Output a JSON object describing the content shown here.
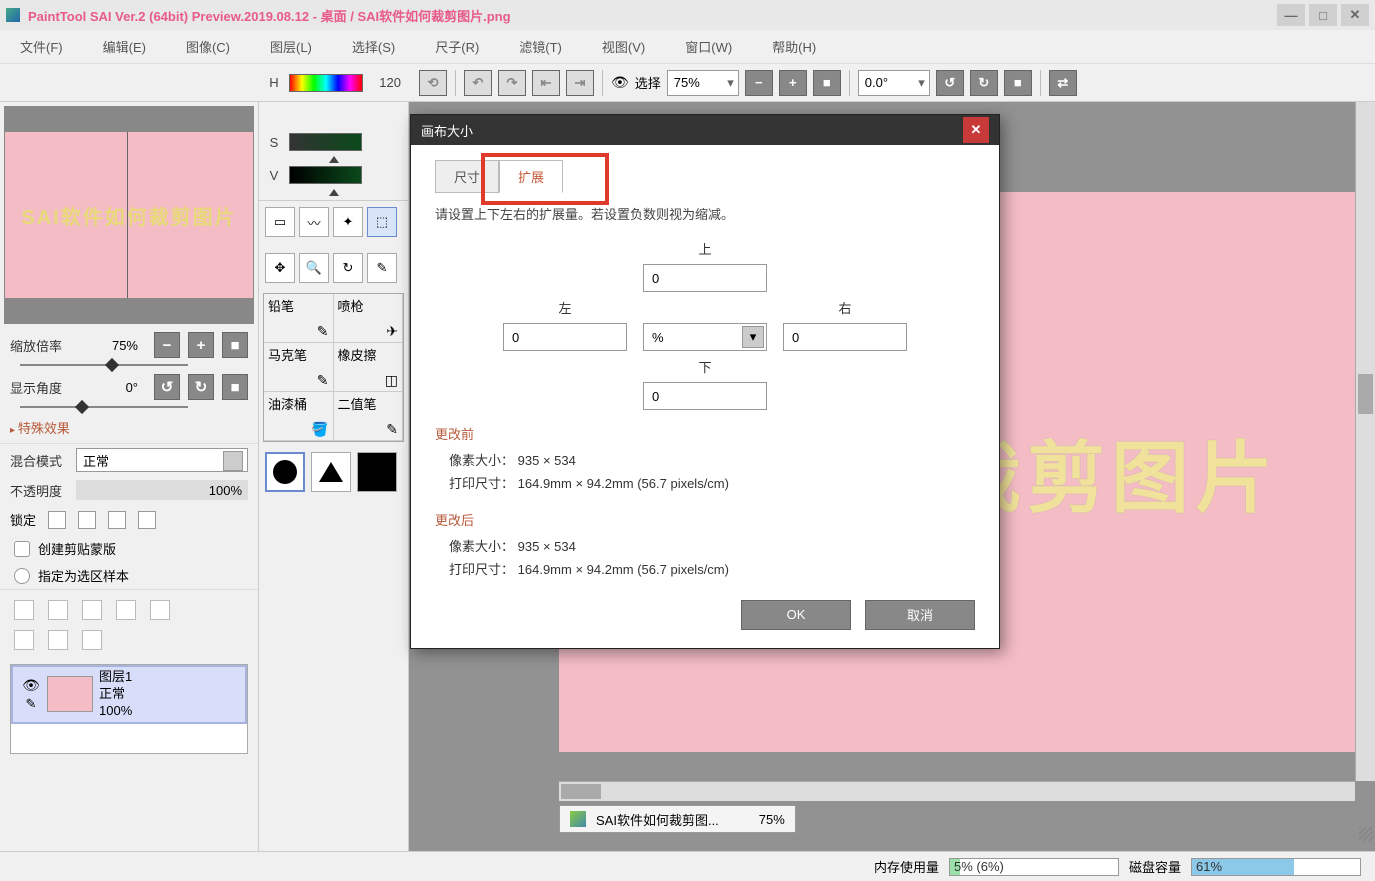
{
  "title": "PaintTool SAI Ver.2 (64bit) Preview.2019.08.12 - 桌面 / SAI软件如何裁剪图片.png",
  "menu": {
    "file": "文件(F)",
    "edit": "编辑(E)",
    "image": "图像(C)",
    "layer": "图层(L)",
    "select": "选择(S)",
    "ruler": "尺子(R)",
    "filter": "滤镜(T)",
    "view": "视图(V)",
    "window": "窗口(W)",
    "help": "帮助(H)"
  },
  "toolbar": {
    "select_label": "选择",
    "zoom": "75%",
    "angle": "0.0°"
  },
  "color": {
    "h": "120",
    "s": "",
    "v": ""
  },
  "nav": {
    "zoom_label": "缩放倍率",
    "zoom_val": "75%",
    "angle_label": "显示角度",
    "angle_val": "0°",
    "preview_text": "SAI软件如何裁剪图片"
  },
  "effects_label": "特殊效果",
  "blend": {
    "label": "混合模式",
    "value": "正常"
  },
  "opacity": {
    "label": "不透明度",
    "value": "100%"
  },
  "lock_label": "锁定",
  "clip_mask": "创建剪贴蒙版",
  "sel_sample": "指定为选区样本",
  "brushes": {
    "r1c1": "铅笔",
    "r1c2": "喷枪",
    "r2c1": "马克笔",
    "r2c2": "橡皮擦",
    "r3c1": "油漆桶",
    "r3c2": "二值笔"
  },
  "layer": {
    "name": "图层1",
    "mode": "正常",
    "opacity": "100%"
  },
  "doc_tab": {
    "name": "SAI软件如何裁剪图...",
    "zoom": "75%"
  },
  "status": {
    "mem_label": "内存使用量",
    "mem_val": "5% (6%)",
    "disk_label": "磁盘容量",
    "disk_val": "61%"
  },
  "canvas_text": "何裁剪图片",
  "dialog": {
    "title": "画布大小",
    "tab1": "尺寸",
    "tab2": "扩展",
    "desc": "请设置上下左右的扩展量。若设置负数则视为缩减。",
    "top": "上",
    "left": "左",
    "right": "右",
    "bottom": "下",
    "val_top": "0",
    "val_left": "0",
    "val_right": "0",
    "val_bottom": "0",
    "unit": "%",
    "before": "更改前",
    "after": "更改后",
    "px_label": "像素大小：",
    "px_val": "935 × 534",
    "print_label": "打印尺寸：",
    "print_val": "164.9mm × 94.2mm (56.7 pixels/cm)",
    "ok": "OK",
    "cancel": "取消"
  }
}
